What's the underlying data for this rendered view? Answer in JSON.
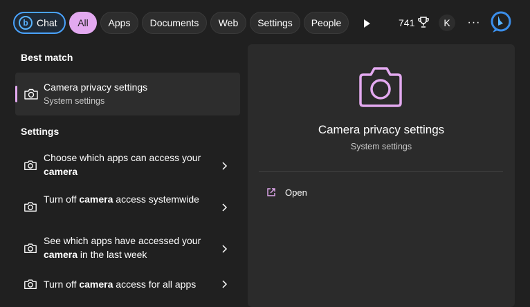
{
  "filters": {
    "chat": "Chat",
    "all": "All",
    "apps": "Apps",
    "documents": "Documents",
    "web": "Web",
    "settings": "Settings",
    "people": "People"
  },
  "toolbar": {
    "points": "741",
    "avatar_initial": "K",
    "more": "···"
  },
  "best_match": {
    "heading": "Best match",
    "title": "Camera privacy settings",
    "subtitle": "System settings"
  },
  "settings_section": {
    "heading": "Settings",
    "items": [
      {
        "pre": "Choose which apps can access your ",
        "bold": "camera",
        "post": ""
      },
      {
        "pre": "Turn off ",
        "bold": "camera",
        "post": " access systemwide"
      },
      {
        "pre": "See which apps have accessed your ",
        "bold": "camera",
        "post": " in the last week"
      },
      {
        "pre": "Turn off ",
        "bold": "camera",
        "post": " access for all apps"
      }
    ]
  },
  "detail": {
    "title": "Camera privacy settings",
    "subtitle": "System settings",
    "open_label": "Open"
  },
  "colors": {
    "accent": "#e3a9f0",
    "chat_border": "#4aa3ff",
    "background": "#202020",
    "panel": "#2b2b2b"
  },
  "icons": [
    "bing-icon",
    "play-icon",
    "trophy-icon",
    "camera-icon",
    "chevron-right-icon",
    "open-external-icon"
  ]
}
